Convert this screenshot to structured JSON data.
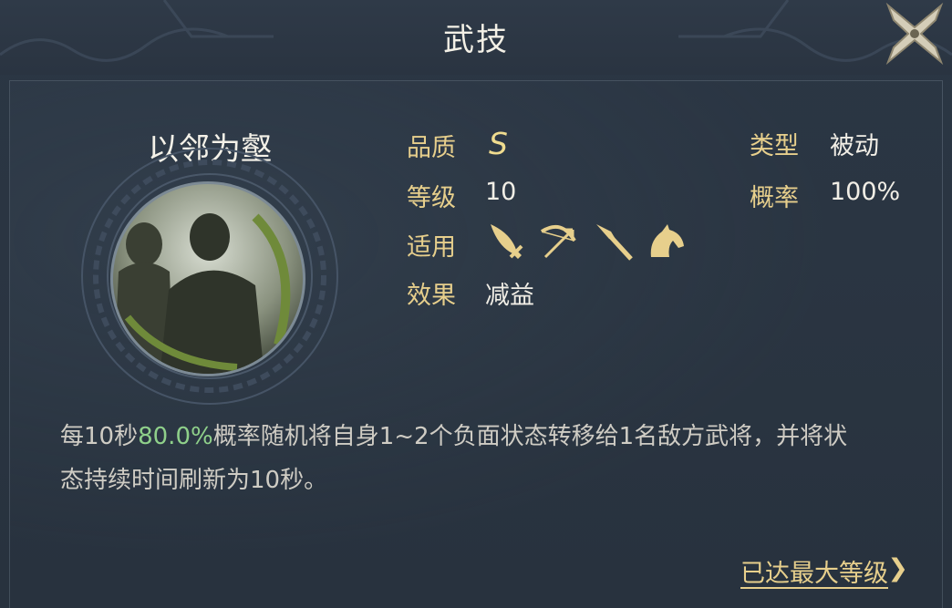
{
  "window": {
    "title": "武技",
    "close_icon": "close-x-icon"
  },
  "skill": {
    "name": "以邻为壑",
    "portrait_icon": "warrior-silhouette-portrait"
  },
  "attributes": {
    "quality_label": "品质",
    "quality_value": "S",
    "level_label": "等级",
    "level_value": "10",
    "applicable_label": "适用",
    "applicable_icons": [
      "sword-icon",
      "bow-icon",
      "spear-icon",
      "horse-icon"
    ],
    "effect_label": "效果",
    "effect_value": "减益",
    "type_label": "类型",
    "type_value": "被动",
    "chance_label": "概率",
    "chance_value": "100%"
  },
  "description": {
    "part1": "每10秒",
    "highlight": "80.0%",
    "part2": "概率随机将自身1~2个负面状态转移给1名敌方武将，并将状态持续时间刷新为10秒。"
  },
  "footer": {
    "max_level_text": "已达最大等级",
    "chevron_icon": "chevron-right-icon"
  },
  "colors": {
    "gold": "#e7cf8c",
    "highlight_green": "#8fd08a",
    "background": "#2a3542"
  }
}
